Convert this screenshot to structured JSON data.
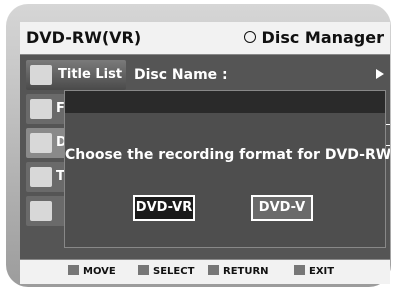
{
  "header": {
    "left_title": "DVD-RW(VR)",
    "right_title": "Disc Manager",
    "right_icon": "circle-icon"
  },
  "menu": {
    "items": [
      {
        "label": "Title List",
        "icon": "title-list-icon"
      },
      {
        "label": "F",
        "icon": "playlist-icon"
      },
      {
        "label": "Disc",
        "icon": "disc-icon"
      },
      {
        "label": "Tir",
        "icon": "timer-icon"
      },
      {
        "label": "",
        "icon": "setup-gear-icon"
      }
    ],
    "disc_name_label": "Disc Name",
    "disc_name_colon": ":"
  },
  "dialog": {
    "message": "Choose the recording format for DVD-RW.",
    "options": [
      "DVD-VR",
      "DVD-V"
    ],
    "selected": "DVD-VR"
  },
  "footer": {
    "move": "MOVE",
    "select": "SELECT",
    "return": "RETURN",
    "exit": "EXIT"
  },
  "colors": {
    "screen_bg": "#555555",
    "header_bg": "#f2f2f2",
    "dialog_bg": "#4e4e4e",
    "selected_button": "#1a1a1a"
  }
}
